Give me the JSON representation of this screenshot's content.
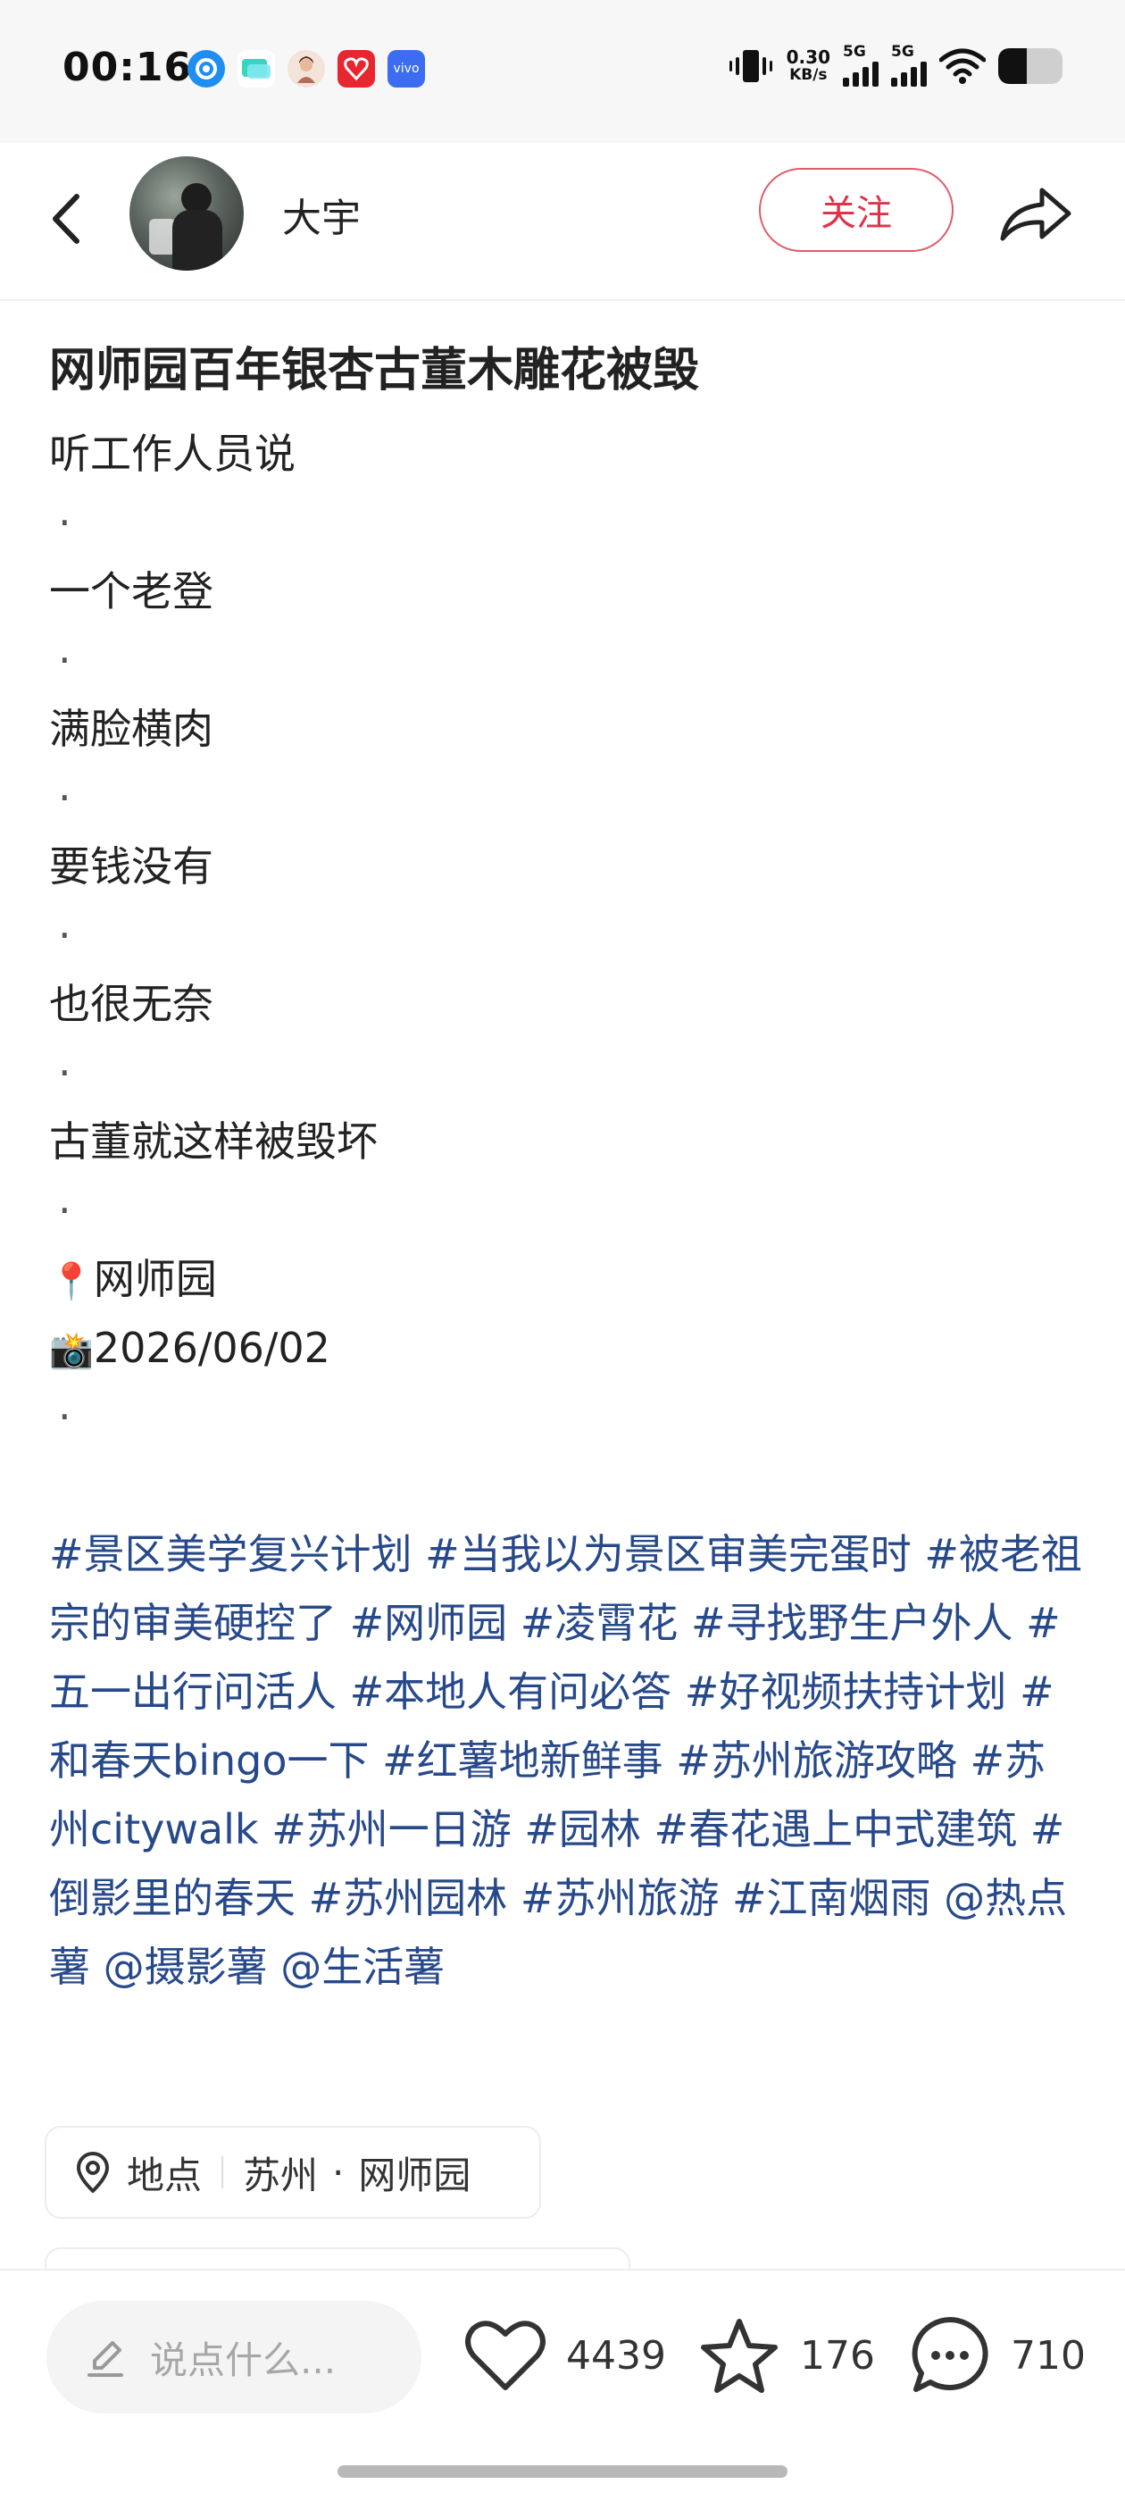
{
  "status_bar": {
    "time": "00:16",
    "net_speed_value": "0.30",
    "net_speed_unit": "KB/s",
    "signal1_label": "5G",
    "signal2_label": "5G",
    "battery_level": 0.45,
    "apps": [
      "c-app-icon",
      "chat-app-icon",
      "avatar-app-icon",
      "heart-app-icon",
      "vivo-app-icon"
    ],
    "vivo_label": "vivo"
  },
  "header": {
    "username": "大宇",
    "follow_label": "关注"
  },
  "post": {
    "title": "网师园百年银杏古董木雕花被毁",
    "lines": [
      "听工作人员说",
      "一个老登",
      "满脸横肉",
      "要钱没有",
      "也很无奈",
      "古董就这样被毁坏"
    ],
    "dot": "·",
    "pin_emoji": "📍",
    "place_text": "网师园",
    "camera_emoji": "📸",
    "date_text": "2026/06/02",
    "tags": [
      "#景区美学复兴计划",
      "#当我以为景区审美完蛋时",
      "#被老祖宗的审美硬控了",
      "#网师园",
      "#凌霄花",
      "#寻找野生户外人",
      "#五一出行问活人",
      "#本地人有问必答",
      "#好视频扶持计划",
      "#和春天bingo一下",
      "#红薯地新鲜事",
      "#苏州旅游攻略",
      "#苏州citywalk",
      "#苏州一日游",
      "#园林",
      "#春花遇上中式建筑",
      "#倒影里的春天",
      "#苏州园林",
      "#苏州旅游",
      "#江南烟雨"
    ],
    "mentions": [
      "@热点薯",
      "@摄影薯",
      "@生活薯"
    ]
  },
  "location": {
    "label": "地点",
    "city": "苏州",
    "separator": "·",
    "place": "网师园"
  },
  "bottom_bar": {
    "comment_placeholder": "说点什么...",
    "likes": "4439",
    "favorites": "176",
    "comments": "710"
  },
  "colors": {
    "accent_red": "#e0334a",
    "tag_blue": "#27498a",
    "text_dark": "#222222"
  }
}
